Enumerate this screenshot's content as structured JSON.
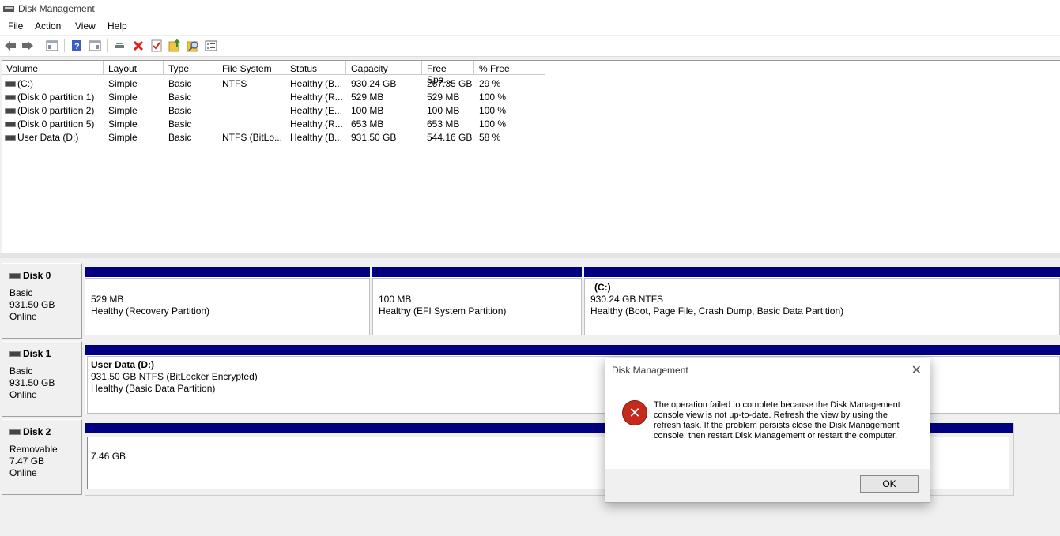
{
  "window": {
    "title": "Disk Management"
  },
  "menu": [
    "File",
    "Action",
    "View",
    "Help"
  ],
  "toolbar": {
    "icons": [
      "back-icon",
      "forward-icon",
      "show-hide-console-tree-icon",
      "help-icon",
      "properties-icon",
      "connect-icon",
      "delete-icon",
      "check-icon",
      "import-icon",
      "search-icon",
      "list-icon"
    ]
  },
  "volumes": {
    "headers": [
      "Volume",
      "Layout",
      "Type",
      "File System",
      "Status",
      "Capacity",
      "Free Spa...",
      "% Free"
    ],
    "rows": [
      [
        "(C:)",
        "Simple",
        "Basic",
        "NTFS",
        "Healthy (B...",
        "930.24 GB",
        "267.35 GB",
        "29 %"
      ],
      [
        "(Disk 0 partition 1)",
        "Simple",
        "Basic",
        "",
        "Healthy (R...",
        "529 MB",
        "529 MB",
        "100 %"
      ],
      [
        "(Disk 0 partition 2)",
        "Simple",
        "Basic",
        "",
        "Healthy (E...",
        "100 MB",
        "100 MB",
        "100 %"
      ],
      [
        "(Disk 0 partition 5)",
        "Simple",
        "Basic",
        "",
        "Healthy (R...",
        "653 MB",
        "653 MB",
        "100 %"
      ],
      [
        "User Data (D:)",
        "Simple",
        "Basic",
        "NTFS (BitLo...",
        "Healthy (B...",
        "931.50 GB",
        "544.16 GB",
        "58 %"
      ]
    ]
  },
  "disks": [
    {
      "name": "Disk 0",
      "type": "Basic",
      "size": "931.50 GB",
      "state": "Online",
      "partitions": [
        {
          "title": "",
          "line1": "529 MB",
          "line2": "Healthy (Recovery Partition)"
        },
        {
          "title": "",
          "line1": "100 MB",
          "line2": "Healthy (EFI System Partition)"
        },
        {
          "title": "(C:)",
          "line1": "930.24 GB NTFS",
          "line2": "Healthy (Boot, Page File, Crash Dump, Basic Data Partition)"
        }
      ]
    },
    {
      "name": "Disk 1",
      "type": "Basic",
      "size": "931.50 GB",
      "state": "Online",
      "partitions": [
        {
          "title": "User Data  (D:)",
          "line1": "931.50 GB NTFS (BitLocker Encrypted)",
          "line2": "Healthy (Basic Data Partition)"
        }
      ]
    },
    {
      "name": "Disk 2",
      "type": "Removable",
      "size": "7.47 GB",
      "state": "Online",
      "partitions": [
        {
          "title": "",
          "line1": "7.46 GB",
          "line2": ""
        }
      ]
    }
  ],
  "dialog": {
    "title": "Disk Management",
    "message": "The operation failed to complete because the Disk Management console view is not up-to-date.  Refresh the view by using the refresh task. If the problem persists close the Disk Management console, then restart Disk Management or restart the computer.",
    "ok_label": "OK",
    "icon": "error-icon",
    "close_glyph": "✕",
    "error_glyph": "✕"
  }
}
